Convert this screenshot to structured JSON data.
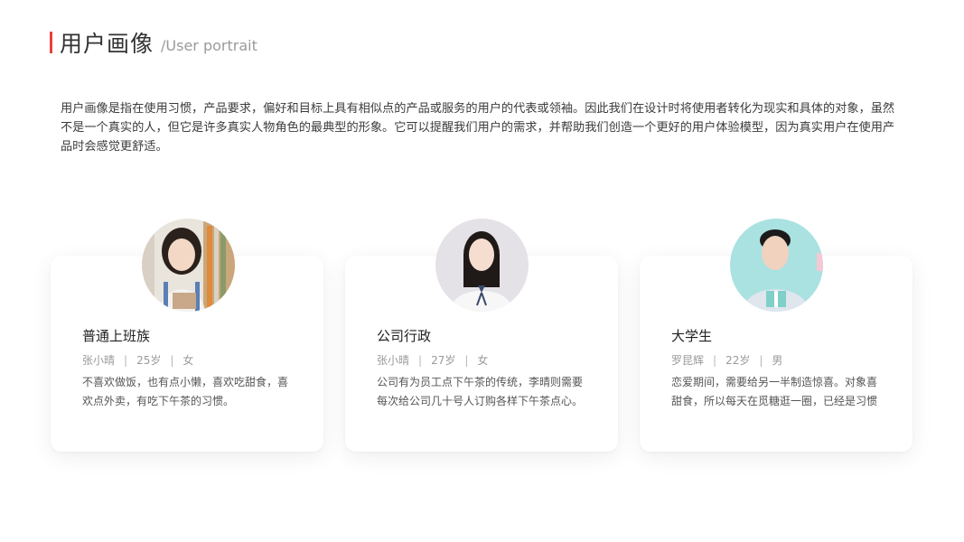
{
  "header": {
    "title": "用户画像",
    "subtitle": "/User portrait",
    "accent_color": "#e8403f"
  },
  "intro": {
    "text": "用户画像是指在使用习惯，产品要求，偏好和目标上具有相似点的产品或服务的用户的代表或领袖。因此我们在设计时将使用者转化为现实和具体的对象，虽然不是一个真实的人，但它是许多真实人物角色的最典型的形象。它可以提醒我们用户的需求，并帮助我们创造一个更好的用户体验模型，因为真实用户在使用产品时会感觉更舒适。"
  },
  "cards": [
    {
      "title": "普通上班族",
      "name": "张小晴",
      "age": "25岁",
      "gender": "女",
      "separator": "|",
      "desc": "不喜欢做饭，也有点小懒，喜欢吃甜食，喜欢点外卖，有吃下午茶的习惯。",
      "avatar_icon": "woman-with-books-photo"
    },
    {
      "title": "公司行政",
      "name": "张小晴",
      "age": "27岁",
      "gender": "女",
      "separator": "|",
      "desc": "公司有为员工点下午茶的传统，李晴则需要每次给公司几十号人订购各样下午茶点心。",
      "avatar_icon": "woman-office-photo"
    },
    {
      "title": "大学生",
      "name": "罗昆辉",
      "age": "22岁",
      "gender": "男",
      "separator": "|",
      "desc": "恋爱期间，需要给另一半制造惊喜。对象喜甜食，所以每天在觅糖逛一圈，已经是习惯",
      "avatar_icon": "young-man-gift-photo"
    }
  ]
}
